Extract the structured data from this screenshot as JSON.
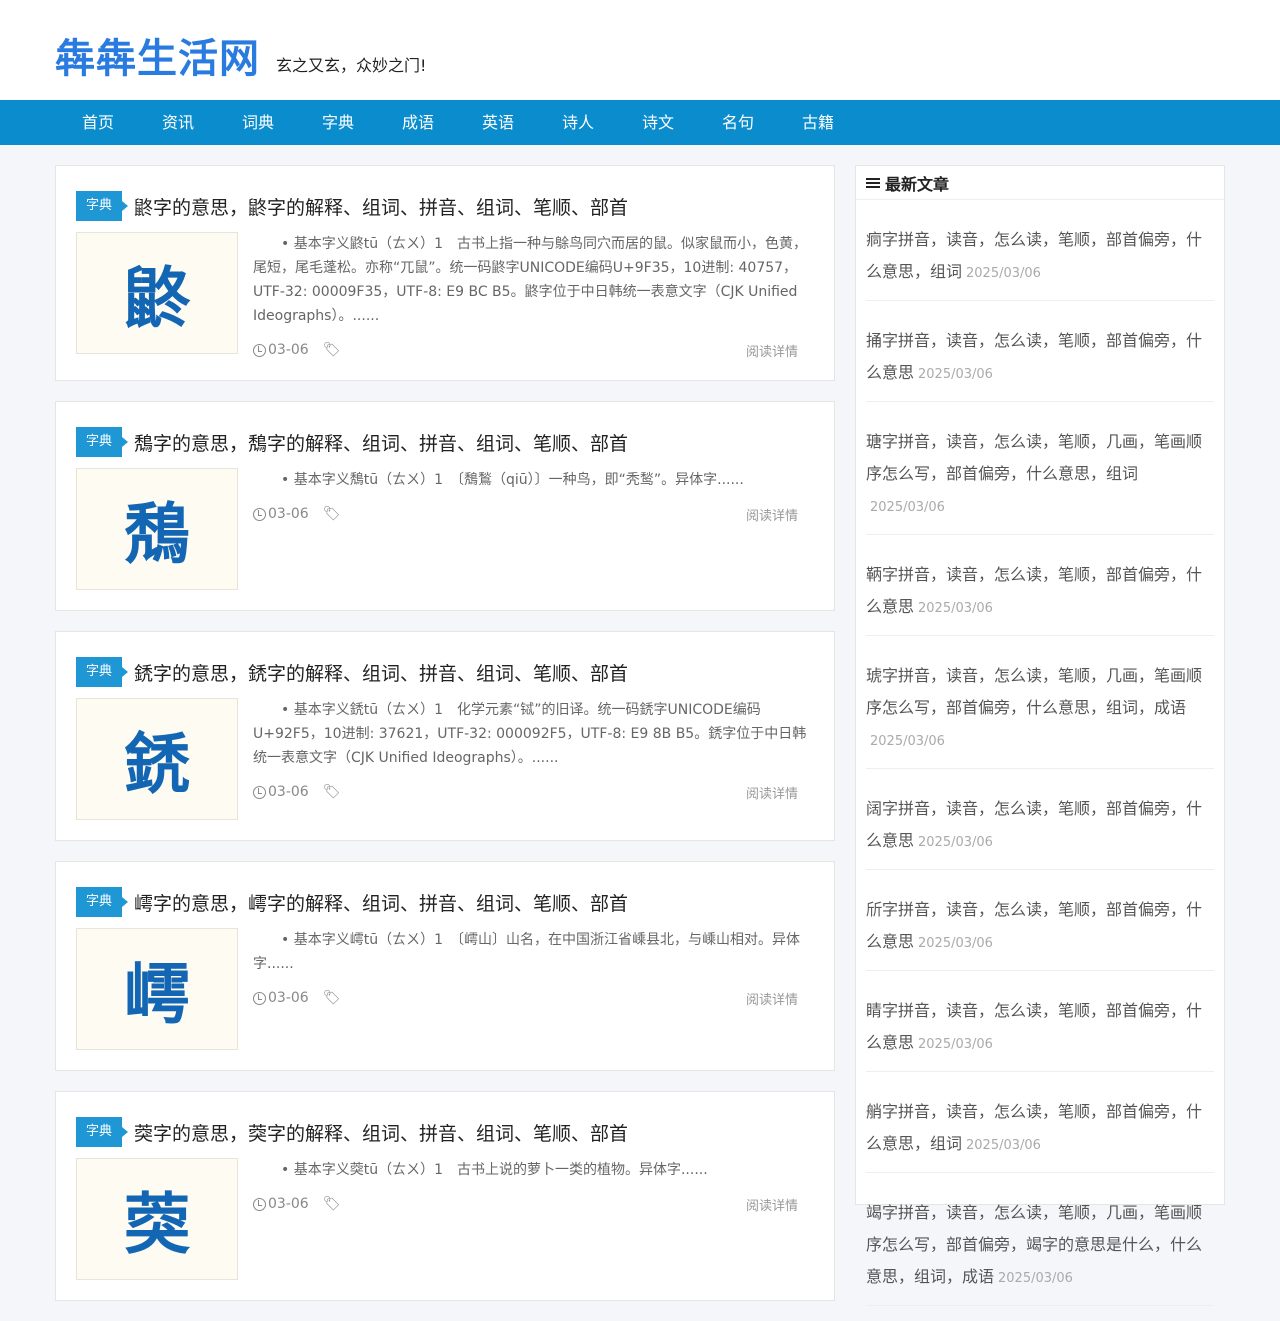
{
  "site": {
    "logo": "犇犇生活网",
    "slogan": "玄之又玄，众妙之门!"
  },
  "nav": [
    "首页",
    "资讯",
    "词典",
    "字典",
    "成语",
    "英语",
    "诗人",
    "诗文",
    "名句",
    "古籍"
  ],
  "posts": [
    {
      "category": "字典",
      "title": "鼨字的意思，鼨字的解释、组词、拼音、组词、笔顺、部首",
      "char": "鼨",
      "excerpt": "• 基本字义鼨tū（ㄊㄨ）1　古书上指一种与鵌鸟同穴而居的鼠。似家鼠而小，色黄，尾短，尾毛蓬松。亦称“兀鼠”。统一码鼨字UNICODE编码U+9F35，10进制: 40757，UTF-32: 00009F35，UTF-8: E9 BC B5。鼨字位于中日韩统一表意文字（CJK Unified Ideographs）。......",
      "date": "03-06",
      "more": "阅读详情"
    },
    {
      "category": "字典",
      "title": "鵚字的意思，鵚字的解释、组词、拼音、组词、笔顺、部首",
      "char": "鵚",
      "excerpt": "• 基本字义鵚tū（ㄊㄨ）1　〔鵚鶖（qiū）〕一种鸟，即“秃鹙”。异体字......",
      "date": "03-06",
      "more": "阅读详情"
    },
    {
      "category": "字典",
      "title": "鋵字的意思，鋵字的解释、组词、拼音、组词、笔顺、部首",
      "char": "鋵",
      "excerpt": "• 基本字义鋵tū（ㄊㄨ）1　化学元素“铽”的旧译。统一码鋵字UNICODE编码U+92F5，10进制: 37621，UTF-32: 000092F5，UTF-8: E9 8B B5。鋵字位于中日韩统一表意文字（CJK Unified Ideographs）。......",
      "date": "03-06",
      "more": "阅读详情"
    },
    {
      "category": "字典",
      "title": "嶀字的意思，嶀字的解释、组词、拼音、组词、笔顺、部首",
      "char": "嶀",
      "excerpt": "• 基本字义嶀tū（ㄊㄨ）1　〔嶀山〕山名，在中国浙江省嵊县北，与嵊山相对。异体字......",
      "date": "03-06",
      "more": "阅读详情"
    },
    {
      "category": "字典",
      "title": "葖字的意思，葖字的解释、组词、拼音、组词、笔顺、部首",
      "char": "葖",
      "excerpt": "• 基本字义葖tū（ㄊㄨ）1　古书上说的萝卜一类的植物。异体字......",
      "date": "03-06",
      "more": "阅读详情"
    }
  ],
  "sidebar": {
    "title": "最新文章",
    "items": [
      {
        "text": "痌字拼音，读音，怎么读，笔顺，部首偏旁，什么意思，组词",
        "date": "2025/03/06"
      },
      {
        "text": "捅字拼音，读音，怎么读，笔顺，部首偏旁，什么意思",
        "date": "2025/03/06"
      },
      {
        "text": "瑭字拼音，读音，怎么读，笔顺，几画，笔画顺序怎么写，部首偏旁，什么意思，组词",
        "date": "2025/03/06"
      },
      {
        "text": "鞆字拼音，读音，怎么读，笔顺，部首偏旁，什么意思",
        "date": "2025/03/06"
      },
      {
        "text": "琥字拼音，读音，怎么读，笔顺，几画，笔画顺序怎么写，部首偏旁，什么意思，组词，成语",
        "date": "2025/03/06"
      },
      {
        "text": "阔字拼音，读音，怎么读，笔顺，部首偏旁，什么意思",
        "date": "2025/03/06"
      },
      {
        "text": "斦字拼音，读音，怎么读，笔顺，部首偏旁，什么意思",
        "date": "2025/03/06"
      },
      {
        "text": "睛字拼音，读音，怎么读，笔顺，部首偏旁，什么意思",
        "date": "2025/03/06"
      },
      {
        "text": "艄字拼音，读音，怎么读，笔顺，部首偏旁，什么意思，组词",
        "date": "2025/03/06"
      },
      {
        "text": "竭字拼音，读音，怎么读，笔顺，几画，笔画顺序怎么写，部首偏旁，竭字的意思是什么，什么意思，组词，成语",
        "date": "2025/03/06"
      }
    ]
  }
}
